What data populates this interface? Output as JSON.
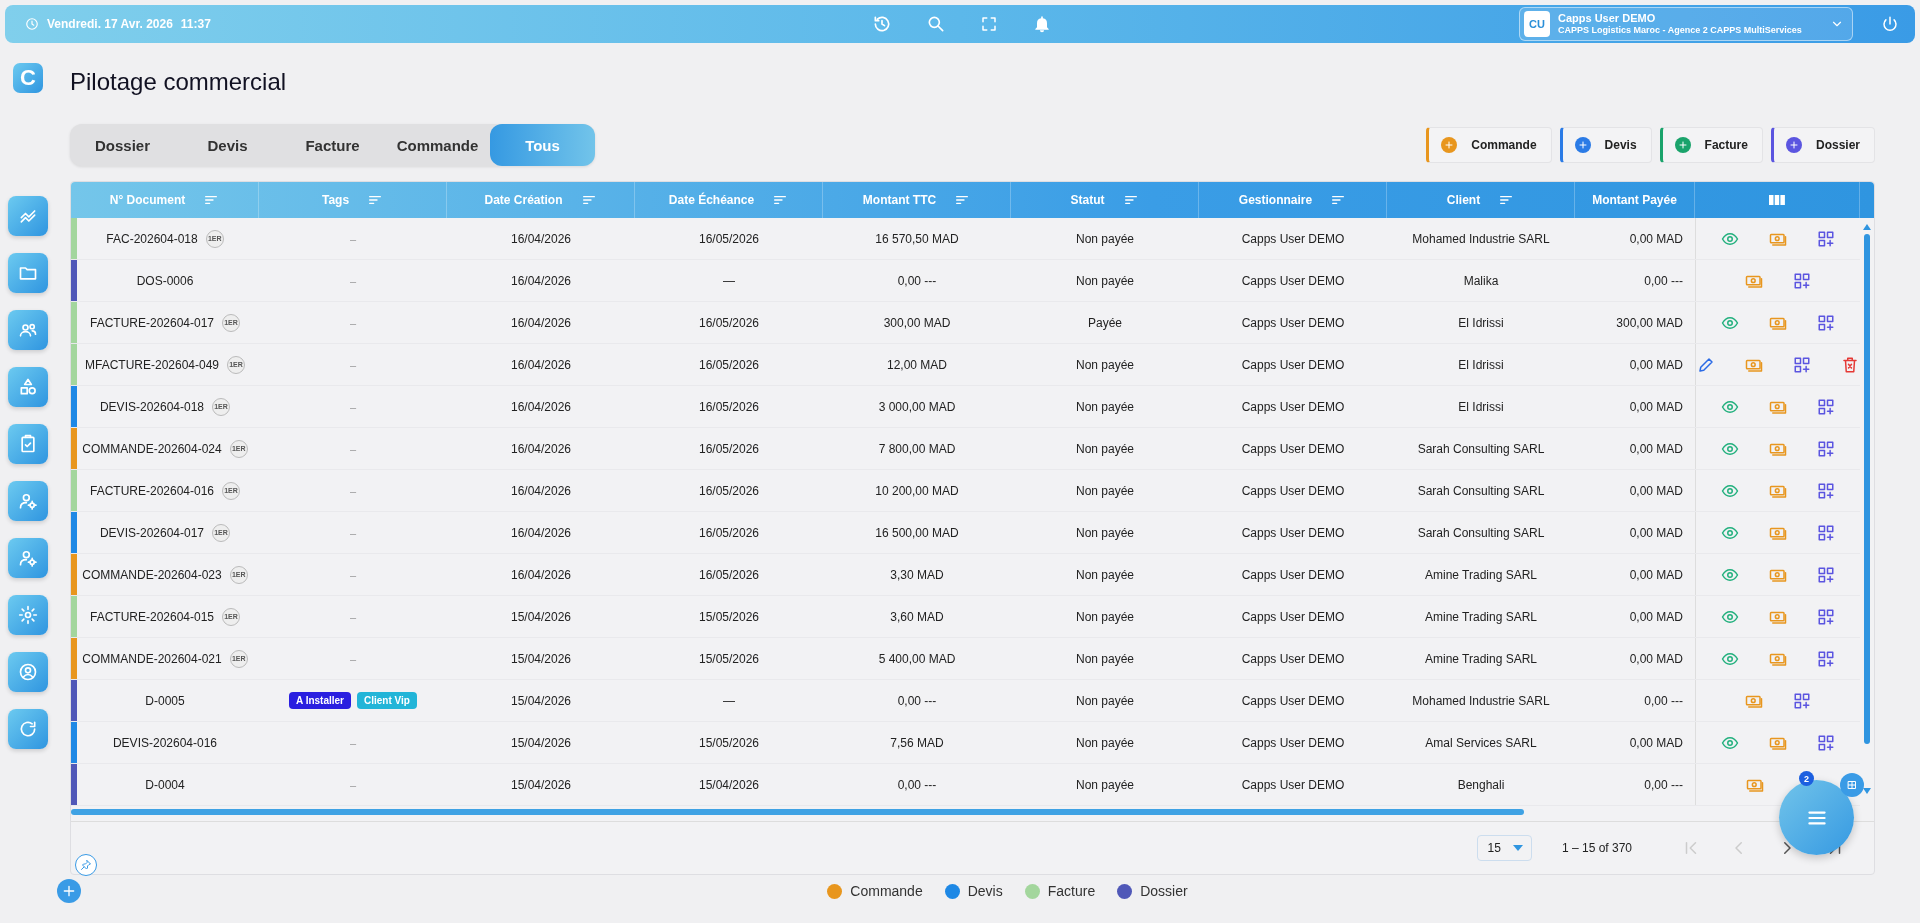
{
  "topbar": {
    "date": "Vendredi. 17 Avr. 2026",
    "time": "11:37",
    "user": {
      "initials": "CU",
      "name": "Capps User DEMO",
      "company": "CAPPS Logistics Maroc - Agence 2 CAPPS MultiServices"
    }
  },
  "logo": "C",
  "title": "Pilotage commercial",
  "tabs": [
    {
      "label": "Dossier",
      "selected": false
    },
    {
      "label": "Devis",
      "selected": false
    },
    {
      "label": "Facture",
      "selected": false
    },
    {
      "label": "Commande",
      "selected": false
    },
    {
      "label": "Tous",
      "selected": true
    }
  ],
  "add_buttons": [
    {
      "label": "Commande",
      "color": "#e8961e"
    },
    {
      "label": "Devis",
      "color": "#2b7be6"
    },
    {
      "label": "Facture",
      "color": "#1aa36b"
    },
    {
      "label": "Dossier",
      "color": "#5b55e0"
    }
  ],
  "table": {
    "columns": [
      {
        "label": "N° Document",
        "sortable": true
      },
      {
        "label": "Tags",
        "sortable": true
      },
      {
        "label": "Date Création",
        "sortable": true
      },
      {
        "label": "Date Échéance",
        "sortable": true
      },
      {
        "label": "Montant TTC",
        "sortable": true
      },
      {
        "label": "Statut",
        "sortable": true
      },
      {
        "label": "Gestionnaire",
        "sortable": true
      },
      {
        "label": "Client",
        "sortable": true
      },
      {
        "label": "Montant Payée",
        "sortable": false
      }
    ],
    "rows": [
      {
        "color": "#a3d69d",
        "document": "FAC-202604-018",
        "badge": "1ER",
        "no_tag": "–",
        "created": "16/04/2026",
        "due": "16/05/2026",
        "amount": "16 570,50 MAD",
        "status": "Non payée",
        "manager": "Capps User DEMO",
        "client": "Mohamed Industrie SARL",
        "paid": "0,00 MAD",
        "actions": [
          {
            "kind": "view"
          },
          {
            "kind": "pay"
          },
          {
            "kind": "add"
          }
        ]
      },
      {
        "color": "#5058b8",
        "document": "DOS-0006",
        "no_tag": "–",
        "created": "16/04/2026",
        "due": "—",
        "amount": "0,00 ---",
        "status": "Non payée",
        "manager": "Capps User DEMO",
        "client": "Malika",
        "paid": "0,00 ---",
        "actions": [
          {
            "kind": "pay"
          },
          {
            "kind": "add"
          }
        ]
      },
      {
        "color": "#a3d69d",
        "document": "FACTURE-202604-017",
        "badge": "1ER",
        "no_tag": "–",
        "created": "16/04/2026",
        "due": "16/05/2026",
        "amount": "300,00 MAD",
        "status": "Payée",
        "manager": "Capps User DEMO",
        "client": "El Idrissi",
        "paid": "300,00 MAD",
        "actions": [
          {
            "kind": "view"
          },
          {
            "kind": "pay"
          },
          {
            "kind": "add"
          }
        ]
      },
      {
        "color": "#a3d69d",
        "document": "MFACTURE-202604-049",
        "badge": "1ER",
        "no_tag": "–",
        "created": "16/04/2026",
        "due": "16/05/2026",
        "amount": "12,00 MAD",
        "status": "Non payée",
        "manager": "Capps User DEMO",
        "client": "El Idrissi",
        "paid": "0,00 MAD",
        "actions": [
          {
            "kind": "edit"
          },
          {
            "kind": "pay"
          },
          {
            "kind": "add"
          },
          {
            "kind": "delete"
          }
        ]
      },
      {
        "color": "#1e88e5",
        "document": "DEVIS-202604-018",
        "badge": "1ER",
        "no_tag": "–",
        "created": "16/04/2026",
        "due": "16/05/2026",
        "amount": "3 000,00 MAD",
        "status": "Non payée",
        "manager": "Capps User DEMO",
        "client": "El Idrissi",
        "paid": "0,00 MAD",
        "actions": [
          {
            "kind": "view"
          },
          {
            "kind": "pay"
          },
          {
            "kind": "add"
          }
        ]
      },
      {
        "color": "#e8961e",
        "document": "COMMANDE-202604-024",
        "badge": "1ER",
        "no_tag": "–",
        "created": "16/04/2026",
        "due": "16/05/2026",
        "amount": "7 800,00 MAD",
        "status": "Non payée",
        "manager": "Capps User DEMO",
        "client": "Sarah Consulting SARL",
        "paid": "0,00 MAD",
        "actions": [
          {
            "kind": "view"
          },
          {
            "kind": "pay"
          },
          {
            "kind": "add"
          }
        ]
      },
      {
        "color": "#a3d69d",
        "document": "FACTURE-202604-016",
        "badge": "1ER",
        "no_tag": "–",
        "created": "16/04/2026",
        "due": "16/05/2026",
        "amount": "10 200,00 MAD",
        "status": "Non payée",
        "manager": "Capps User DEMO",
        "client": "Sarah Consulting SARL",
        "paid": "0,00 MAD",
        "actions": [
          {
            "kind": "view"
          },
          {
            "kind": "pay"
          },
          {
            "kind": "add"
          }
        ]
      },
      {
        "color": "#1e88e5",
        "document": "DEVIS-202604-017",
        "badge": "1ER",
        "no_tag": "–",
        "created": "16/04/2026",
        "due": "16/05/2026",
        "amount": "16 500,00 MAD",
        "status": "Non payée",
        "manager": "Capps User DEMO",
        "client": "Sarah Consulting SARL",
        "paid": "0,00 MAD",
        "actions": [
          {
            "kind": "view"
          },
          {
            "kind": "pay"
          },
          {
            "kind": "add"
          }
        ]
      },
      {
        "color": "#e8961e",
        "document": "COMMANDE-202604-023",
        "badge": "1ER",
        "no_tag": "–",
        "created": "16/04/2026",
        "due": "16/05/2026",
        "amount": "3,30 MAD",
        "status": "Non payée",
        "manager": "Capps User DEMO",
        "client": "Amine Trading SARL",
        "paid": "0,00 MAD",
        "actions": [
          {
            "kind": "view"
          },
          {
            "kind": "pay"
          },
          {
            "kind": "add"
          }
        ]
      },
      {
        "color": "#a3d69d",
        "document": "FACTURE-202604-015",
        "badge": "1ER",
        "no_tag": "–",
        "created": "15/04/2026",
        "due": "15/05/2026",
        "amount": "3,60 MAD",
        "status": "Non payée",
        "manager": "Capps User DEMO",
        "client": "Amine Trading SARL",
        "paid": "0,00 MAD",
        "actions": [
          {
            "kind": "view"
          },
          {
            "kind": "pay"
          },
          {
            "kind": "add"
          }
        ]
      },
      {
        "color": "#e8961e",
        "document": "COMMANDE-202604-021",
        "badge": "1ER",
        "no_tag": "–",
        "created": "15/04/2026",
        "due": "15/05/2026",
        "amount": "5 400,00 MAD",
        "status": "Non payée",
        "manager": "Capps User DEMO",
        "client": "Amine Trading SARL",
        "paid": "0,00 MAD",
        "actions": [
          {
            "kind": "view"
          },
          {
            "kind": "pay"
          },
          {
            "kind": "add"
          }
        ]
      },
      {
        "color": "#5058b8",
        "document": "D-0005",
        "tags": [
          {
            "label": "A Installer",
            "color": "#2a1fe0"
          },
          {
            "label": "Client Vip",
            "color": "#22b5d8"
          }
        ],
        "created": "15/04/2026",
        "due": "—",
        "amount": "0,00 ---",
        "status": "Non payée",
        "manager": "Capps User DEMO",
        "client": "Mohamed Industrie SARL",
        "paid": "0,00 ---",
        "actions": [
          {
            "kind": "pay"
          },
          {
            "kind": "add"
          }
        ]
      },
      {
        "color": "#1e88e5",
        "document": "DEVIS-202604-016",
        "no_tag": "–",
        "created": "15/04/2026",
        "due": "15/05/2026",
        "amount": "7,56 MAD",
        "status": "Non payée",
        "manager": "Capps User DEMO",
        "client": "Amal Services SARL",
        "paid": "0,00 MAD",
        "actions": [
          {
            "kind": "view"
          },
          {
            "kind": "pay"
          },
          {
            "kind": "add"
          }
        ]
      },
      {
        "color": "#5058b8",
        "document": "D-0004",
        "no_tag": "–",
        "created": "15/04/2026",
        "due": "15/04/2026",
        "amount": "0,00 ---",
        "status": "Non payée",
        "manager": "Capps User DEMO",
        "client": "Benghali",
        "paid": "0,00 ---",
        "actions": [
          {
            "kind": "pay"
          }
        ]
      }
    ]
  },
  "pagination": {
    "page_size": "15",
    "range": "1 – 15 of 370"
  },
  "fab": {
    "badge": "2"
  },
  "legend": [
    {
      "label": "Commande",
      "color": "#e8961e"
    },
    {
      "label": "Devis",
      "color": "#1e88e5"
    },
    {
      "label": "Facture",
      "color": "#a3d69d"
    },
    {
      "label": "Dossier",
      "color": "#5058b8"
    }
  ]
}
